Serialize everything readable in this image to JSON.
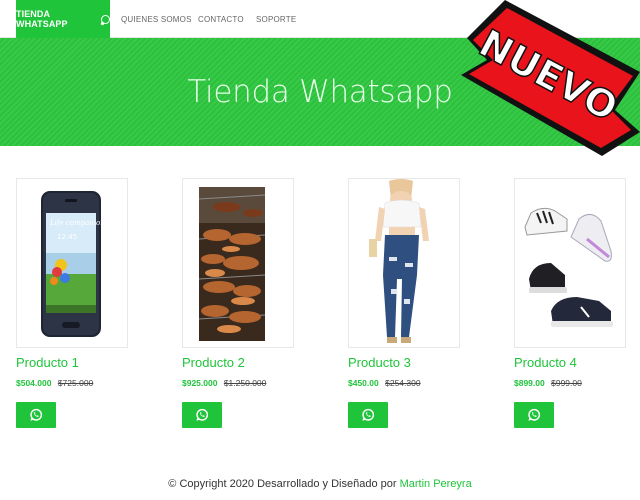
{
  "navbar": {
    "brand": "TIENDA WHATSAPP",
    "links": [
      "QUIENES SOMOS",
      "CONTACTO",
      "SOPORTE"
    ]
  },
  "hero": {
    "title": "Tienda Whatsapp"
  },
  "badge": {
    "text": "NUEVO"
  },
  "products": [
    {
      "name": "Producto 1",
      "price": "$504.000",
      "old_price": "$725.000"
    },
    {
      "name": "Producto 2",
      "price": "$925.000",
      "old_price": "$1.250.000"
    },
    {
      "name": "Producto 3",
      "price": "$450.00",
      "old_price": "$254.300"
    },
    {
      "name": "Producto 4",
      "price": "$899.00",
      "old_price": "$999.00"
    }
  ],
  "phone_screen": {
    "tagline": "Life companion",
    "time": "12:45"
  },
  "footer": {
    "text": "© Copyright 2020 Desarrollado y Diseñado por",
    "author": "Martin Pereyra"
  },
  "colors": {
    "brand_green": "#1fc43a",
    "hero_green": "#2dc63f",
    "badge_red": "#e8131b"
  },
  "icons": {
    "order_button": "whatsapp-icon",
    "brand": "whatsapp-icon"
  }
}
